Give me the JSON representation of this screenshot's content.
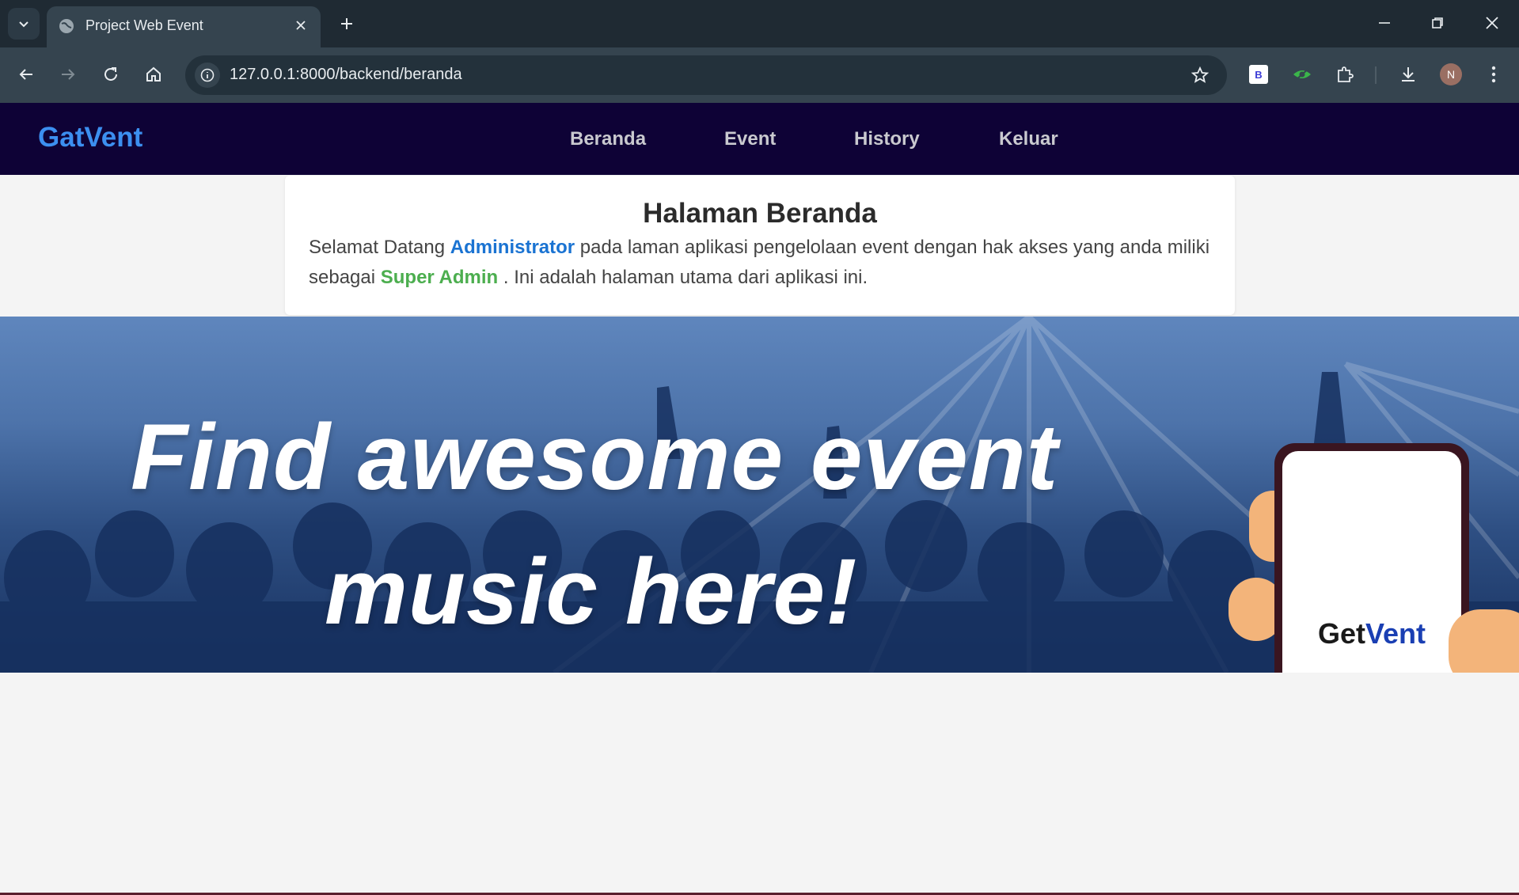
{
  "browser": {
    "tab_title": "Project Web Event",
    "url": "127.0.0.1:8000/backend/beranda",
    "profile_initial": "N",
    "extension_b_label": "B"
  },
  "navbar": {
    "brand": "GatVent",
    "items": [
      {
        "label": "Beranda"
      },
      {
        "label": "Event"
      },
      {
        "label": "History"
      },
      {
        "label": "Keluar"
      }
    ]
  },
  "welcome": {
    "title": "Halaman Beranda",
    "text_1": "Selamat Datang ",
    "user_name": "Administrator",
    "text_2": " pada laman aplikasi pengelolaan event dengan hak akses yang anda miliki sebagai ",
    "role": "Super Admin",
    "text_3": " . Ini adalah halaman utama dari aplikasi ini."
  },
  "banner": {
    "line_1": "Find awesome event",
    "line_2": "music here!",
    "phone_logo_get": "Get",
    "phone_logo_vent": "Vent"
  },
  "colors": {
    "navbar_bg": "#0e0236",
    "brand": "#3c8ff0",
    "user_highlight": "#1a73d2",
    "role_highlight": "#4cae4f"
  }
}
